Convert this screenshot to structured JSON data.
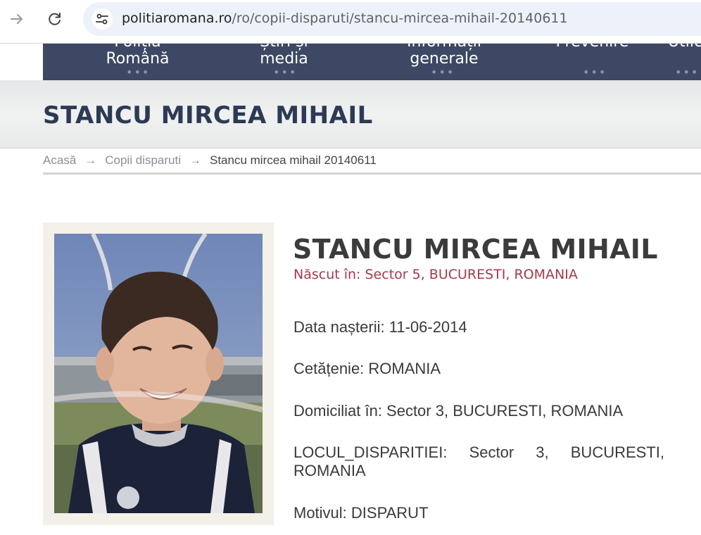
{
  "browser": {
    "url_host": "politiaromana.ro",
    "url_path": "/ro/copii-disparuti/stancu-mircea-mihail-20140611"
  },
  "nav": {
    "items": [
      {
        "line1": "Poliția",
        "line2": "Română"
      },
      {
        "line1": "Știri și",
        "line2": "media"
      },
      {
        "line1": "Informații",
        "line2": "generale"
      },
      {
        "line1": "",
        "line2": "Prevenire"
      },
      {
        "line1": "",
        "line2": "Utile"
      }
    ]
  },
  "page": {
    "title": "STANCU MIRCEA MIHAIL"
  },
  "breadcrumb": {
    "home": "Acasă",
    "section": "Copii disparuti",
    "current": "Stancu mircea mihail 20140611"
  },
  "person": {
    "name": "STANCU MIRCEA MIHAIL",
    "born": "Născut în: Sector 5, BUCURESTI, ROMANIA",
    "birth_date": "Data nașterii: 11-06-2014",
    "citizenship": "Cetățenie: ROMANIA",
    "residence": "Domiciliat în: Sector 3, BUCURESTI, ROMANIA",
    "disappearance_place": "LOCUL_DISPARITIEI: Sector 3, BUCURESTI, ROMANIA",
    "reason": "Motivul: DISPARUT"
  },
  "colors": {
    "nav_bg": "#3c4864",
    "title_color": "#2c3a55",
    "born_color": "#a33a4d",
    "card_bg": "#f2f0e9"
  }
}
